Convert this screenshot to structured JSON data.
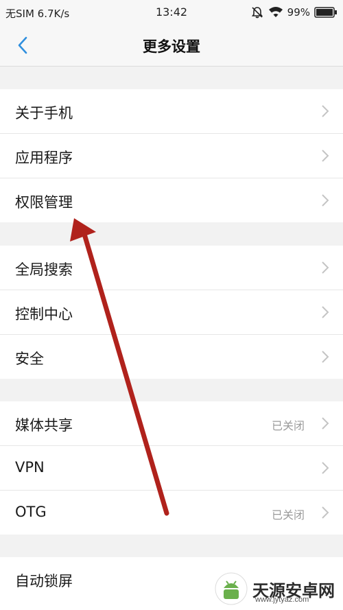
{
  "status_bar": {
    "carrier": "无SIM 6.7K/s",
    "time": "13:42",
    "battery": "99%"
  },
  "nav": {
    "title": "更多设置"
  },
  "groups": [
    {
      "items": [
        {
          "label": "关于手机"
        },
        {
          "label": "应用程序"
        },
        {
          "label": "权限管理"
        }
      ]
    },
    {
      "items": [
        {
          "label": "全局搜索"
        },
        {
          "label": "控制中心"
        },
        {
          "label": "安全"
        }
      ]
    },
    {
      "items": [
        {
          "label": "媒体共享",
          "value": "已关闭"
        },
        {
          "label": "VPN"
        },
        {
          "label": "OTG",
          "value": "已关闭"
        }
      ]
    },
    {
      "items": [
        {
          "label": "自动锁屏"
        }
      ]
    }
  ],
  "watermark": {
    "text": "天源安卓网",
    "url": "www.jytyaz.com"
  },
  "colors": {
    "accent": "#2f8fde",
    "annotation_arrow": "#b0221c"
  }
}
